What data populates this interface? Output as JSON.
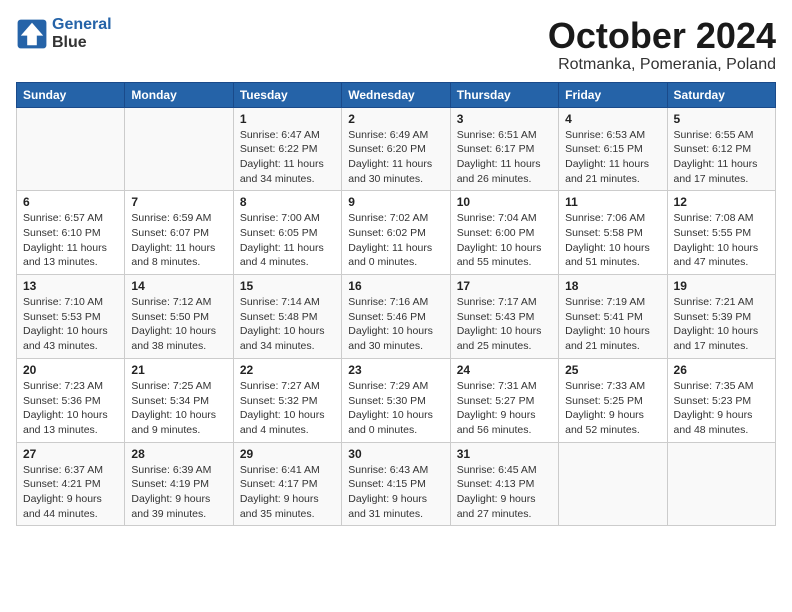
{
  "header": {
    "logo_line1": "General",
    "logo_line2": "Blue",
    "month": "October 2024",
    "location": "Rotmanka, Pomerania, Poland"
  },
  "days_of_week": [
    "Sunday",
    "Monday",
    "Tuesday",
    "Wednesday",
    "Thursday",
    "Friday",
    "Saturday"
  ],
  "weeks": [
    [
      {
        "day": "",
        "info": ""
      },
      {
        "day": "",
        "info": ""
      },
      {
        "day": "1",
        "info": "Sunrise: 6:47 AM\nSunset: 6:22 PM\nDaylight: 11 hours\nand 34 minutes."
      },
      {
        "day": "2",
        "info": "Sunrise: 6:49 AM\nSunset: 6:20 PM\nDaylight: 11 hours\nand 30 minutes."
      },
      {
        "day": "3",
        "info": "Sunrise: 6:51 AM\nSunset: 6:17 PM\nDaylight: 11 hours\nand 26 minutes."
      },
      {
        "day": "4",
        "info": "Sunrise: 6:53 AM\nSunset: 6:15 PM\nDaylight: 11 hours\nand 21 minutes."
      },
      {
        "day": "5",
        "info": "Sunrise: 6:55 AM\nSunset: 6:12 PM\nDaylight: 11 hours\nand 17 minutes."
      }
    ],
    [
      {
        "day": "6",
        "info": "Sunrise: 6:57 AM\nSunset: 6:10 PM\nDaylight: 11 hours\nand 13 minutes."
      },
      {
        "day": "7",
        "info": "Sunrise: 6:59 AM\nSunset: 6:07 PM\nDaylight: 11 hours\nand 8 minutes."
      },
      {
        "day": "8",
        "info": "Sunrise: 7:00 AM\nSunset: 6:05 PM\nDaylight: 11 hours\nand 4 minutes."
      },
      {
        "day": "9",
        "info": "Sunrise: 7:02 AM\nSunset: 6:02 PM\nDaylight: 11 hours\nand 0 minutes."
      },
      {
        "day": "10",
        "info": "Sunrise: 7:04 AM\nSunset: 6:00 PM\nDaylight: 10 hours\nand 55 minutes."
      },
      {
        "day": "11",
        "info": "Sunrise: 7:06 AM\nSunset: 5:58 PM\nDaylight: 10 hours\nand 51 minutes."
      },
      {
        "day": "12",
        "info": "Sunrise: 7:08 AM\nSunset: 5:55 PM\nDaylight: 10 hours\nand 47 minutes."
      }
    ],
    [
      {
        "day": "13",
        "info": "Sunrise: 7:10 AM\nSunset: 5:53 PM\nDaylight: 10 hours\nand 43 minutes."
      },
      {
        "day": "14",
        "info": "Sunrise: 7:12 AM\nSunset: 5:50 PM\nDaylight: 10 hours\nand 38 minutes."
      },
      {
        "day": "15",
        "info": "Sunrise: 7:14 AM\nSunset: 5:48 PM\nDaylight: 10 hours\nand 34 minutes."
      },
      {
        "day": "16",
        "info": "Sunrise: 7:16 AM\nSunset: 5:46 PM\nDaylight: 10 hours\nand 30 minutes."
      },
      {
        "day": "17",
        "info": "Sunrise: 7:17 AM\nSunset: 5:43 PM\nDaylight: 10 hours\nand 25 minutes."
      },
      {
        "day": "18",
        "info": "Sunrise: 7:19 AM\nSunset: 5:41 PM\nDaylight: 10 hours\nand 21 minutes."
      },
      {
        "day": "19",
        "info": "Sunrise: 7:21 AM\nSunset: 5:39 PM\nDaylight: 10 hours\nand 17 minutes."
      }
    ],
    [
      {
        "day": "20",
        "info": "Sunrise: 7:23 AM\nSunset: 5:36 PM\nDaylight: 10 hours\nand 13 minutes."
      },
      {
        "day": "21",
        "info": "Sunrise: 7:25 AM\nSunset: 5:34 PM\nDaylight: 10 hours\nand 9 minutes."
      },
      {
        "day": "22",
        "info": "Sunrise: 7:27 AM\nSunset: 5:32 PM\nDaylight: 10 hours\nand 4 minutes."
      },
      {
        "day": "23",
        "info": "Sunrise: 7:29 AM\nSunset: 5:30 PM\nDaylight: 10 hours\nand 0 minutes."
      },
      {
        "day": "24",
        "info": "Sunrise: 7:31 AM\nSunset: 5:27 PM\nDaylight: 9 hours\nand 56 minutes."
      },
      {
        "day": "25",
        "info": "Sunrise: 7:33 AM\nSunset: 5:25 PM\nDaylight: 9 hours\nand 52 minutes."
      },
      {
        "day": "26",
        "info": "Sunrise: 7:35 AM\nSunset: 5:23 PM\nDaylight: 9 hours\nand 48 minutes."
      }
    ],
    [
      {
        "day": "27",
        "info": "Sunrise: 6:37 AM\nSunset: 4:21 PM\nDaylight: 9 hours\nand 44 minutes."
      },
      {
        "day": "28",
        "info": "Sunrise: 6:39 AM\nSunset: 4:19 PM\nDaylight: 9 hours\nand 39 minutes."
      },
      {
        "day": "29",
        "info": "Sunrise: 6:41 AM\nSunset: 4:17 PM\nDaylight: 9 hours\nand 35 minutes."
      },
      {
        "day": "30",
        "info": "Sunrise: 6:43 AM\nSunset: 4:15 PM\nDaylight: 9 hours\nand 31 minutes."
      },
      {
        "day": "31",
        "info": "Sunrise: 6:45 AM\nSunset: 4:13 PM\nDaylight: 9 hours\nand 27 minutes."
      },
      {
        "day": "",
        "info": ""
      },
      {
        "day": "",
        "info": ""
      }
    ]
  ]
}
